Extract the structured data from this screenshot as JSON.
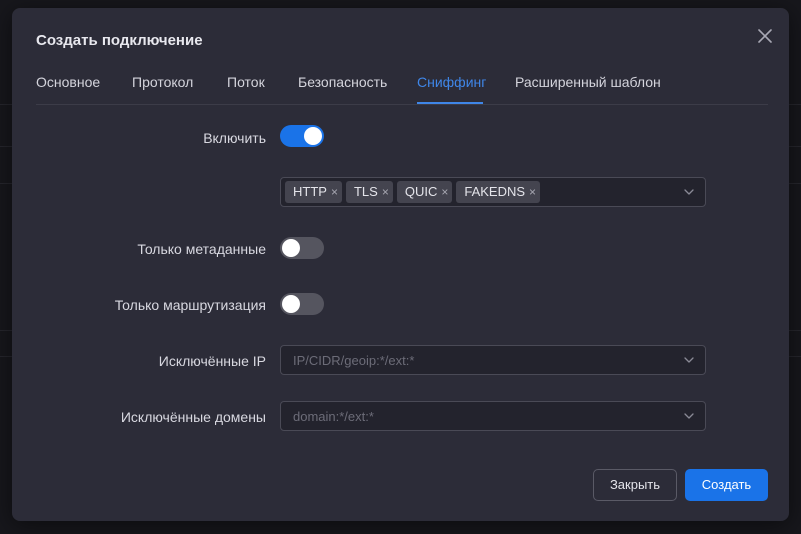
{
  "dialog": {
    "title": "Создать подключение",
    "close_icon": "close-icon"
  },
  "tabs": [
    {
      "label": "Основное",
      "active": false
    },
    {
      "label": "Протокол",
      "active": false
    },
    {
      "label": "Поток",
      "active": false
    },
    {
      "label": "Безопасность",
      "active": false
    },
    {
      "label": "Сниффинг",
      "active": true
    },
    {
      "label": "Расширенный шаблон",
      "active": false
    }
  ],
  "form": {
    "enable": {
      "label": "Включить",
      "value": true
    },
    "protocols": {
      "tags": [
        {
          "label": "HTTP",
          "remove": "×"
        },
        {
          "label": "TLS",
          "remove": "×"
        },
        {
          "label": "QUIC",
          "remove": "×"
        },
        {
          "label": "FAKEDNS",
          "remove": "×"
        }
      ]
    },
    "metadata_only": {
      "label": "Только метаданные",
      "value": false
    },
    "route_only": {
      "label": "Только маршрутизация",
      "value": false
    },
    "excluded_ip": {
      "label": "Исключённые IP",
      "placeholder": "IP/CIDR/geoip:*/ext:*"
    },
    "excluded_domains": {
      "label": "Исключённые домены",
      "placeholder": "domain:*/ext:*"
    }
  },
  "footer": {
    "close_label": "Закрыть",
    "create_label": "Создать"
  },
  "colors": {
    "accent": "#1a73e8",
    "active_tab": "#3f86e8",
    "dialog_bg": "#2c2c38"
  }
}
